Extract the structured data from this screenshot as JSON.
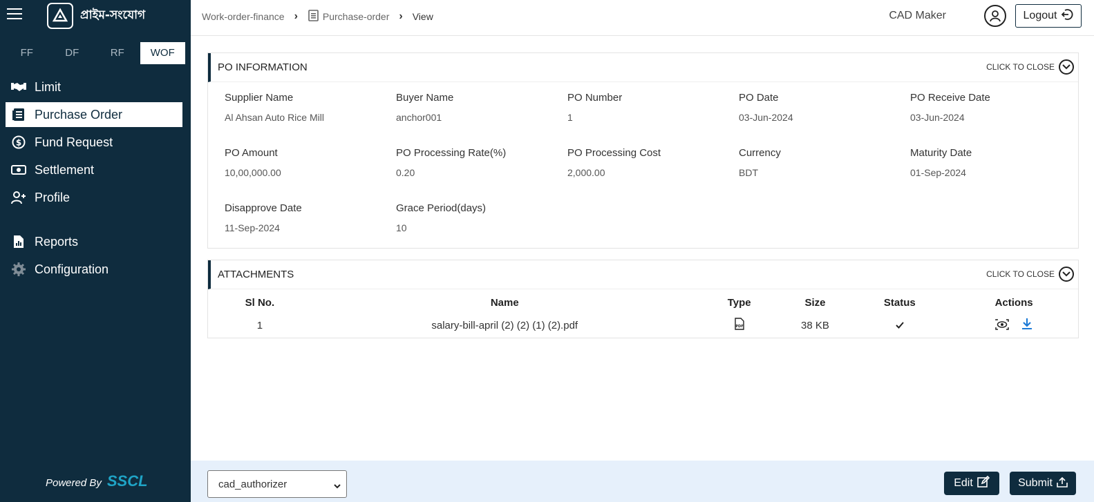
{
  "sidebar": {
    "logo_text": "প্রাইম-সংযোগ",
    "tabs": [
      "FF",
      "DF",
      "RF",
      "WOF"
    ],
    "active_tab": "WOF",
    "items": [
      {
        "label": "Limit",
        "icon": "handshake-icon"
      },
      {
        "label": "Purchase Order",
        "icon": "document-list-icon",
        "active": true
      },
      {
        "label": "Fund Request",
        "icon": "dollar-circle-icon"
      },
      {
        "label": "Settlement",
        "icon": "banknote-icon"
      },
      {
        "label": "Profile",
        "icon": "user-plus-icon"
      },
      {
        "label": "Reports",
        "icon": "report-file-icon"
      },
      {
        "label": "Configuration",
        "icon": "gear-icon"
      }
    ],
    "powered_label": "Powered By",
    "powered_brand": "SSCL"
  },
  "header": {
    "breadcrumb": [
      "Work-order-finance",
      "Purchase-order",
      "View"
    ],
    "user_name": "CAD Maker",
    "logout_label": "Logout"
  },
  "po_info": {
    "title": "PO INFORMATION",
    "close_label": "CLICK TO CLOSE",
    "fields": [
      {
        "label": "Supplier Name",
        "value": "Al Ahsan Auto Rice Mill"
      },
      {
        "label": "Buyer Name",
        "value": "anchor001"
      },
      {
        "label": "PO Number",
        "value": "1"
      },
      {
        "label": "PO Date",
        "value": "03-Jun-2024"
      },
      {
        "label": "PO Receive Date",
        "value": "03-Jun-2024"
      },
      {
        "label": "PO Amount",
        "value": "10,00,000.00"
      },
      {
        "label": "PO Processing Rate(%)",
        "value": "0.20"
      },
      {
        "label": "PO Processing Cost",
        "value": "2,000.00"
      },
      {
        "label": "Currency",
        "value": "BDT"
      },
      {
        "label": "Maturity Date",
        "value": "01-Sep-2024"
      },
      {
        "label": "Disapprove Date",
        "value": "11-Sep-2024"
      },
      {
        "label": "Grace Period(days)",
        "value": "10"
      }
    ]
  },
  "attachments": {
    "title": "ATTACHMENTS",
    "close_label": "CLICK TO CLOSE",
    "columns": [
      "Sl No.",
      "Name",
      "Type",
      "Size",
      "Status",
      "Actions"
    ],
    "rows": [
      {
        "sl": "1",
        "name": "salary-bill-april (2) (2) (1) (2).pdf",
        "type_icon": "pdf-file-icon",
        "size": "38 KB",
        "status_icon": "checkmark-icon"
      }
    ]
  },
  "footer": {
    "select_value": "cad_authorizer",
    "edit_label": "Edit",
    "submit_label": "Submit"
  }
}
